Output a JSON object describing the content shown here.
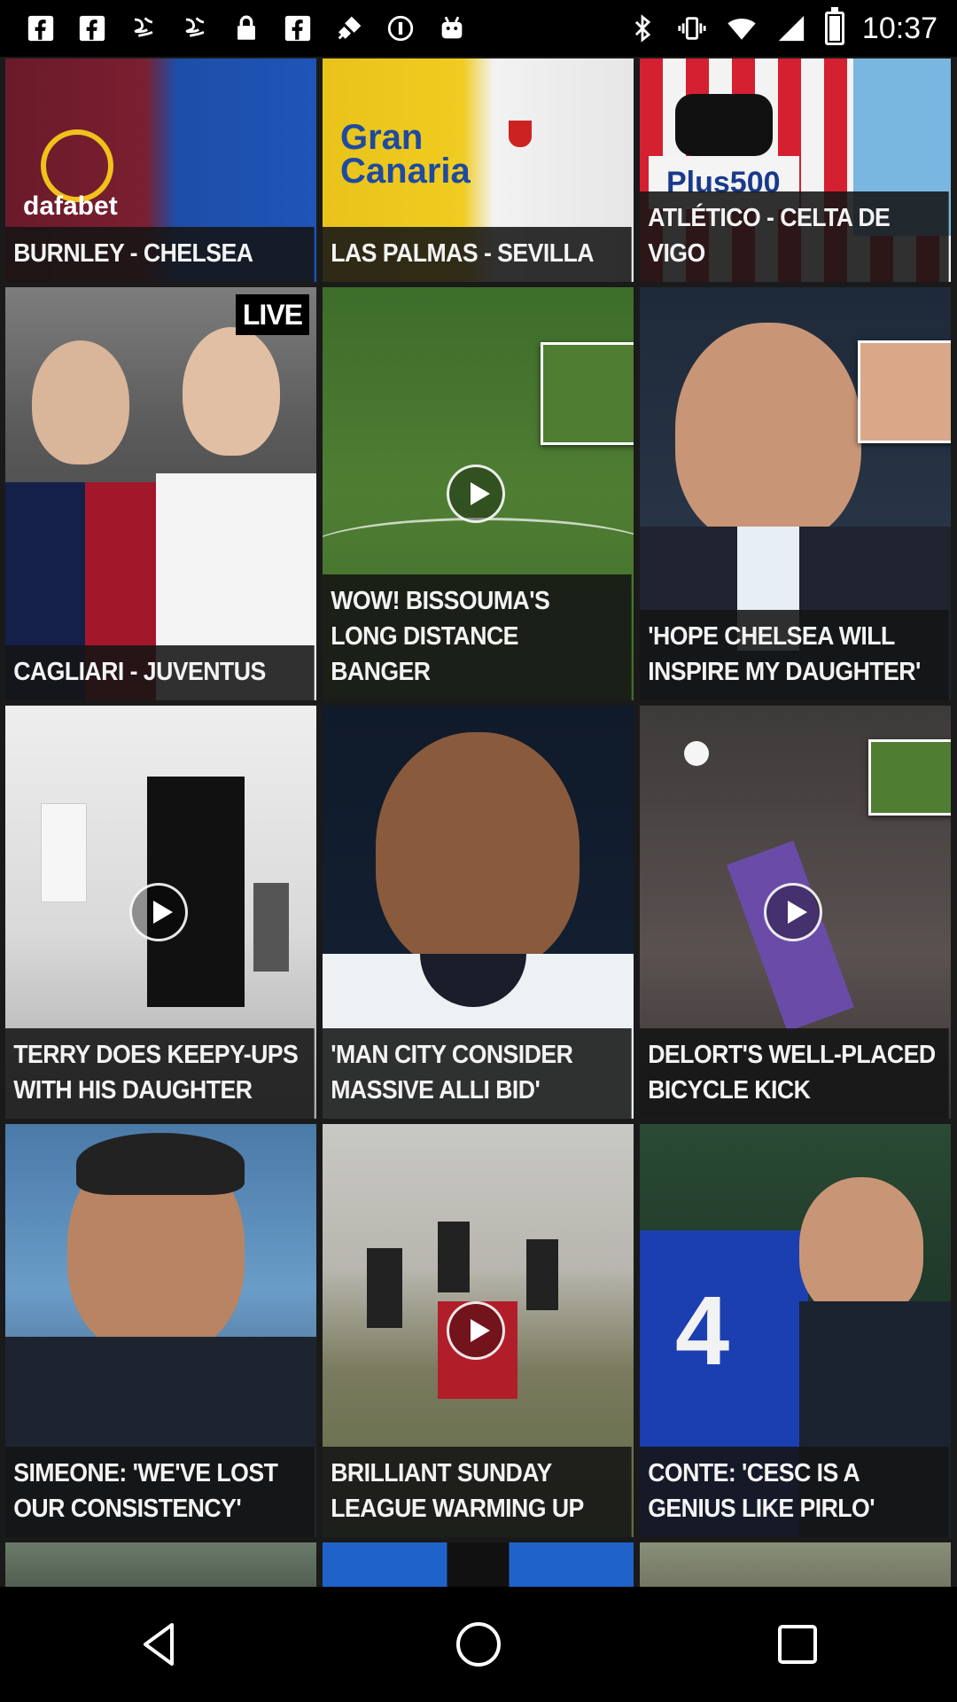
{
  "status_bar": {
    "time": "10:37",
    "left_icons": [
      "facebook-icon",
      "facebook-icon",
      "app-icon",
      "app-icon",
      "lock-icon",
      "facebook-icon",
      "fake-gps-icon",
      "info-icon",
      "android-icon"
    ],
    "right_icons": [
      "bluetooth-icon",
      "vibrate-icon",
      "wifi-icon",
      "signal-icon",
      "battery-icon"
    ]
  },
  "tiles": [
    {
      "caption": "BURNLEY - CHELSEA",
      "type": "match"
    },
    {
      "caption": "LAS PALMAS - SEVILLA",
      "type": "match"
    },
    {
      "caption": "ATLÉTICO - CELTA DE VIGO",
      "type": "match"
    },
    {
      "caption": "CAGLIARI - JUVENTUS",
      "type": "match",
      "badge": "LIVE"
    },
    {
      "caption": "WOW! BISSOUMA'S LONG DISTANCE BANGER",
      "type": "video"
    },
    {
      "caption": "'HOPE CHELSEA WILL INSPIRE MY DAUGHTER'",
      "type": "article"
    },
    {
      "caption": "TERRY DOES KEEPY-UPS WITH HIS DAUGHTER",
      "type": "video"
    },
    {
      "caption": "'MAN CITY CONSIDER MASSIVE ALLI BID'",
      "type": "article"
    },
    {
      "caption": "DELORT'S WELL-PLACED BICYCLE KICK",
      "type": "video"
    },
    {
      "caption": "SIMEONE: 'WE'VE LOST OUR CONSISTENCY'",
      "type": "article"
    },
    {
      "caption": "BRILLIANT SUNDAY LEAGUE WARMING UP",
      "type": "video"
    },
    {
      "caption": "CONTE: 'CESC IS A GENIUS LIKE PIRLO'",
      "type": "article"
    }
  ],
  "navigation": {
    "buttons": [
      "back-icon",
      "home-icon",
      "recents-icon"
    ]
  }
}
